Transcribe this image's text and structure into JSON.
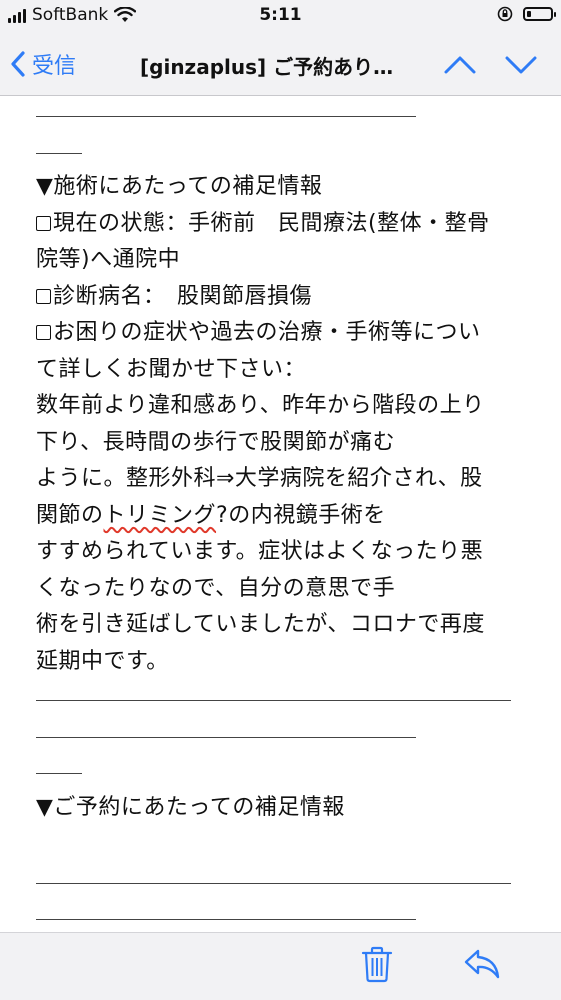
{
  "status_bar": {
    "carrier": "SoftBank",
    "time": "5:11",
    "battery_level": 0.2
  },
  "nav": {
    "back_label": "受信",
    "title": "[ginzaplus] ご予約あり…",
    "up_icon": "chevron-up-icon",
    "down_icon": "chevron-down-icon"
  },
  "email": {
    "section1_heading": "▼施術にあたっての補足情報",
    "item1_line1": "現在の状態：手術前　民間療法(整体・整骨",
    "item1_line2": "院等)へ通院中",
    "item2": "診断病名：　股関節唇損傷",
    "item3_line1": "お困りの症状や過去の治療・手術等につい",
    "item3_line2": "て詳しくお聞かせ下さい：",
    "body_lines": [
      "数年前より違和感あり、昨年から階段の上り",
      "下り、長時間の歩行で股関節が痛む",
      "ように。整形外科⇒大学病院を紹介され、股"
    ],
    "body_line4_pre": "関節の",
    "body_line4_flagged": "トリミング",
    "body_line4_post": "?の内視鏡手術を",
    "body_lines_b": [
      "すすめられています。症状はよくなったり悪",
      "くなったりなので、自分の意思で手",
      "術を引き延ばしていましたが、コロナで再度",
      "延期中です。"
    ],
    "section2_heading": "▼ご予約にあたっての補足情報"
  },
  "toolbar": {
    "trash_icon": "trash-icon",
    "reply_icon": "reply-icon"
  },
  "colors": {
    "accent": "#2f7cf6",
    "spellcheck": "#e0392b"
  }
}
